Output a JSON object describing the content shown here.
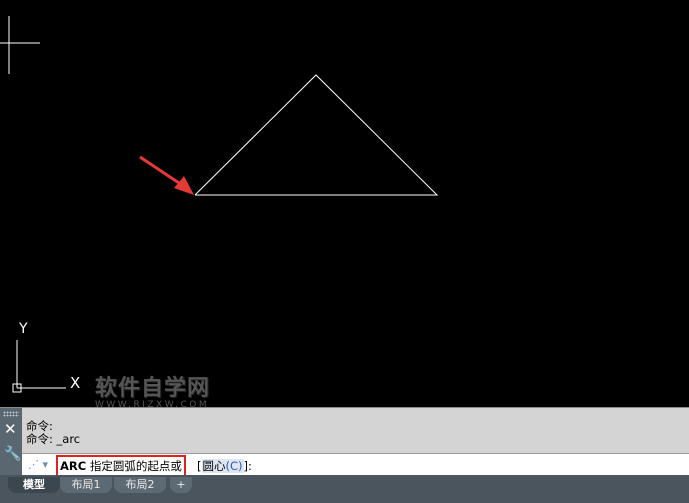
{
  "command_history": [
    "命令:",
    "命令: _arc"
  ],
  "command_line": {
    "command": "ARC",
    "prompt": "指定圆弧的起点或",
    "options_open": "[",
    "option_label": "圆心",
    "option_key": "(C)",
    "options_close": "]:"
  },
  "tabs": [
    {
      "label": "模型",
      "active": true
    },
    {
      "label": "布局1",
      "active": false
    },
    {
      "label": "布局2",
      "active": false
    },
    {
      "label": "+",
      "active": false
    }
  ],
  "ucs": {
    "y_label": "Y",
    "x_label": "X"
  },
  "watermark": {
    "main": "软件自学网",
    "sub": "WWW.RJZXW.COM"
  },
  "colors": {
    "canvas": "#000000",
    "line": "#ffffff",
    "arrow": "#e53935",
    "highlight": "#e0221c"
  },
  "icons": {
    "close": "close-icon",
    "wrench": "wrench-icon",
    "prompt": "command-prompt-icon"
  }
}
